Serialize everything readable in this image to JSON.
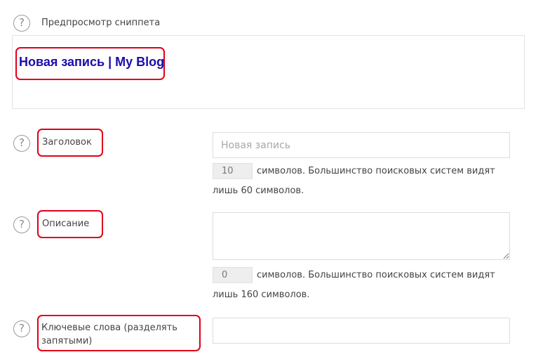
{
  "snippet": {
    "help_icon": "?",
    "label": "Предпросмотр сниппета",
    "title": "Новая запись | My Blog"
  },
  "title_field": {
    "help_icon": "?",
    "label": "Заголовок",
    "value": "",
    "placeholder": "Новая запись",
    "count": "10",
    "hint_line1": "символов. Большинство поисковых систем видят",
    "hint_line2": "лишь 60 символов."
  },
  "description_field": {
    "help_icon": "?",
    "label": "Описание",
    "value": "",
    "count": "0",
    "hint_line1": "символов. Большинство поисковых систем видят",
    "hint_line2": "лишь 160 символов."
  },
  "keywords_field": {
    "help_icon": "?",
    "label_line1": "Ключевые слова (разделять",
    "label_line2": "запятыми)",
    "value": ""
  },
  "colors": {
    "highlight": "#e0001a",
    "snippet_title": "#1a0dab"
  }
}
